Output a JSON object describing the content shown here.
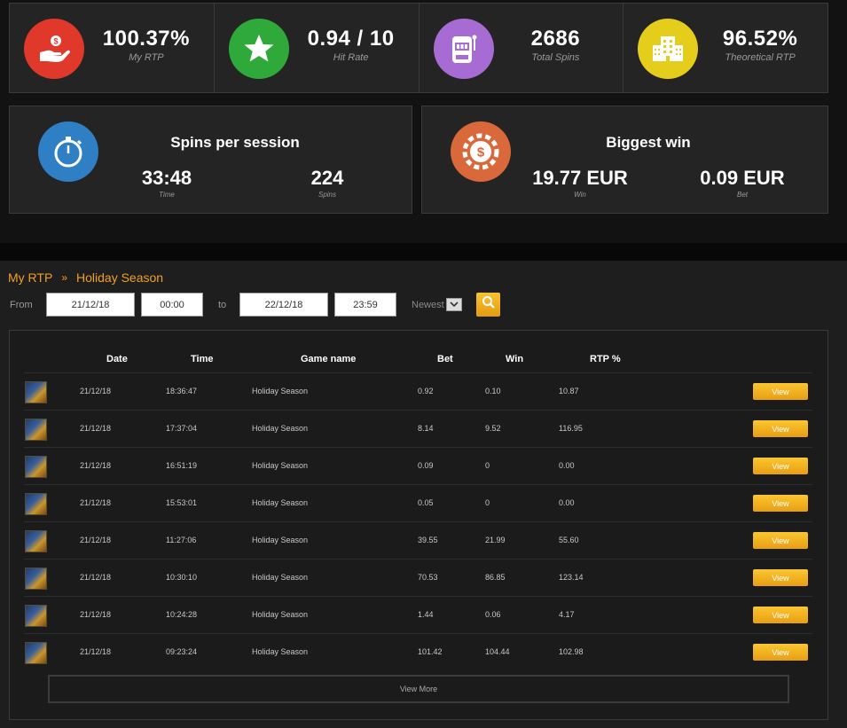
{
  "stats": [
    {
      "value": "100.37%",
      "label": "My RTP",
      "color": "#e0392b",
      "icon": "money-hand-icon"
    },
    {
      "value": "0.94 / 10",
      "label": "Hit Rate",
      "color": "#2faa3a",
      "icon": "star-icon"
    },
    {
      "value": "2686",
      "label": "Total Spins",
      "color": "#a66cd4",
      "icon": "slot-machine-icon"
    },
    {
      "value": "96.52%",
      "label": "Theoretical RTP",
      "color": "#e5cd1c",
      "icon": "building-icon"
    }
  ],
  "spins_panel": {
    "title": "Spins per session",
    "time_value": "33:48",
    "time_label": "Time",
    "spins_value": "224",
    "spins_label": "Spins",
    "color": "#2f7fc4",
    "icon": "stopwatch-icon"
  },
  "win_panel": {
    "title": "Biggest win",
    "win_value": "19.77 EUR",
    "win_label": "Win",
    "bet_value": "0.09 EUR",
    "bet_label": "Bet",
    "color": "#d9683a",
    "icon": "casino-chip-icon"
  },
  "breadcrumb": {
    "root": "My RTP",
    "separator": "»",
    "current": "Holiday Season"
  },
  "filters": {
    "from_label": "From",
    "from_date": "21/12/18",
    "from_time": "00:00",
    "to_label": "to",
    "to_date": "22/12/18",
    "to_time": "23:59",
    "sort": "Newest"
  },
  "table": {
    "headers": {
      "date": "Date",
      "time": "Time",
      "game": "Game name",
      "bet": "Bet",
      "win": "Win",
      "rtp": "RTP %"
    },
    "view_label": "View",
    "rows": [
      {
        "date": "21/12/18",
        "time": "18:36:47",
        "game": "Holiday Season",
        "bet": "0.92",
        "win": "0.10",
        "rtp": "10.87"
      },
      {
        "date": "21/12/18",
        "time": "17:37:04",
        "game": "Holiday Season",
        "bet": "8.14",
        "win": "9.52",
        "rtp": "116.95"
      },
      {
        "date": "21/12/18",
        "time": "16:51:19",
        "game": "Holiday Season",
        "bet": "0.09",
        "win": "0",
        "rtp": "0.00"
      },
      {
        "date": "21/12/18",
        "time": "15:53:01",
        "game": "Holiday Season",
        "bet": "0.05",
        "win": "0",
        "rtp": "0.00"
      },
      {
        "date": "21/12/18",
        "time": "11:27:06",
        "game": "Holiday Season",
        "bet": "39.55",
        "win": "21.99",
        "rtp": "55.60"
      },
      {
        "date": "21/12/18",
        "time": "10:30:10",
        "game": "Holiday Season",
        "bet": "70.53",
        "win": "86.85",
        "rtp": "123.14"
      },
      {
        "date": "21/12/18",
        "time": "10:24:28",
        "game": "Holiday Season",
        "bet": "1.44",
        "win": "0.06",
        "rtp": "4.17"
      },
      {
        "date": "21/12/18",
        "time": "09:23:24",
        "game": "Holiday Season",
        "bet": "101.42",
        "win": "104.44",
        "rtp": "102.98"
      }
    ],
    "view_more_label": "View More"
  }
}
